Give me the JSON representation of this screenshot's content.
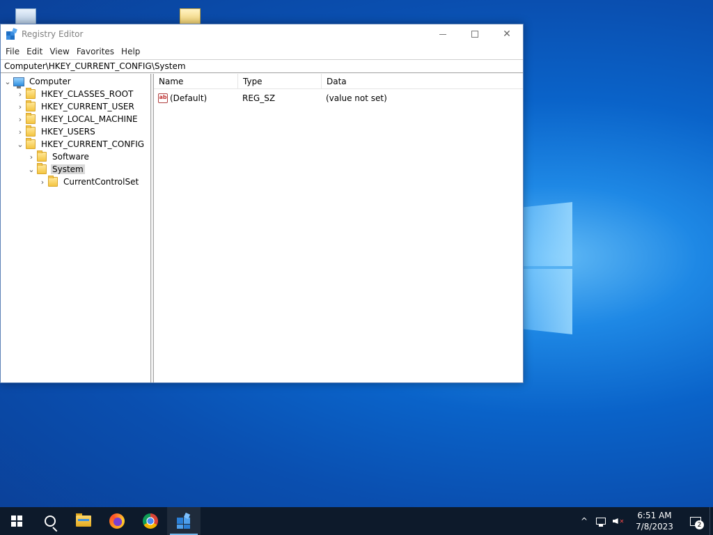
{
  "window": {
    "title": "Registry Editor",
    "controls": {
      "minimize": "",
      "maximize": "",
      "close": "✕"
    }
  },
  "menu": [
    "File",
    "Edit",
    "View",
    "Favorites",
    "Help"
  ],
  "address": "Computer\\HKEY_CURRENT_CONFIG\\System",
  "tree": {
    "root": "Computer",
    "hives": [
      {
        "label": "HKEY_CLASSES_ROOT",
        "expanded": false
      },
      {
        "label": "HKEY_CURRENT_USER",
        "expanded": false
      },
      {
        "label": "HKEY_LOCAL_MACHINE",
        "expanded": false
      },
      {
        "label": "HKEY_USERS",
        "expanded": false
      },
      {
        "label": "HKEY_CURRENT_CONFIG",
        "expanded": true
      }
    ],
    "current_config_children": [
      {
        "label": "Software",
        "expanded": false
      },
      {
        "label": "System",
        "expanded": true,
        "selected": true
      }
    ],
    "system_children": [
      {
        "label": "CurrentControlSet",
        "expanded": false
      }
    ]
  },
  "list": {
    "columns": [
      "Name",
      "Type",
      "Data"
    ],
    "rows": [
      {
        "name": "(Default)",
        "type": "REG_SZ",
        "data": "(value not set)",
        "icon": "string-value-icon",
        "icon_text": "ab"
      }
    ]
  },
  "taskbar": {
    "apps": [
      "start-icon",
      "search-icon",
      "file-explorer-icon",
      "firefox-icon",
      "chrome-icon",
      "registry-editor-icon"
    ],
    "clock_time": "6:51 AM",
    "clock_date": "7/8/2023",
    "notification_count": "2",
    "tray_chevron": "^"
  }
}
